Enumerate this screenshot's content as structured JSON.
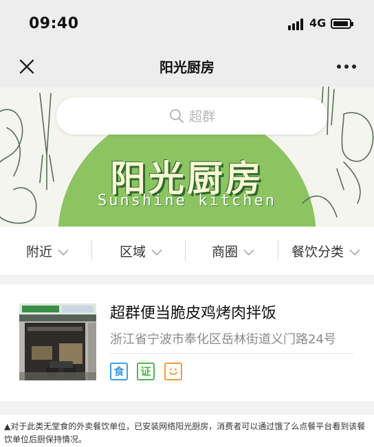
{
  "status_bar": {
    "time": "09:40",
    "network": "4G",
    "icons": [
      "signal-icon",
      "battery-icon"
    ]
  },
  "nav": {
    "title": "阳光厨房",
    "icons": [
      "close-icon",
      "more-icon"
    ]
  },
  "banner": {
    "search_placeholder": "超群",
    "title_cn": "阳光厨房",
    "title_en": "Sunshine kitchen",
    "colors": {
      "circle": "#8cc462",
      "background": "#f4f5ef"
    }
  },
  "filters": [
    {
      "label": "附近"
    },
    {
      "label": "区域"
    },
    {
      "label": "商圈"
    },
    {
      "label": "餐饮分类"
    }
  ],
  "listing": {
    "name": "超群便当脆皮鸡烤肉拌饭",
    "address": "浙江省宁波市奉化区岳林街道义门路24号",
    "badges": [
      {
        "text": "食",
        "color": "#3d9be9"
      },
      {
        "text": "证",
        "color": "#4cb84a"
      },
      {
        "text": "",
        "icon": "smile-icon",
        "color": "#f29a38"
      }
    ]
  },
  "caption": "▲对于此类无堂食的外卖餐饮单位，已安装网络阳光厨房，消费者可以通过饿了么点餐平台看到该餐饮单位后厨保持情况。"
}
